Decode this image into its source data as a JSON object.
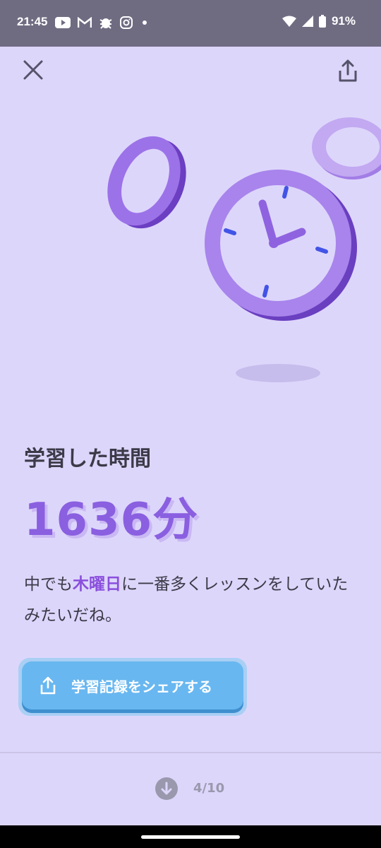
{
  "status_bar": {
    "time": "21:45",
    "notification_icons": [
      "youtube-icon",
      "gmail-icon",
      "bug-icon",
      "instagram-icon",
      "dot-icon"
    ],
    "battery": "91%"
  },
  "header": {
    "close_icon": "close-icon",
    "share_icon": "share-icon"
  },
  "stats": {
    "title": "学習した時間",
    "value": "1636分",
    "description_before": "中でも",
    "description_highlight": "木曜日",
    "description_after": "に一番多くレッスンをしていたみたいだね。"
  },
  "share_button": {
    "label": "学習記録をシェアする"
  },
  "pager": {
    "page_label": "4/10"
  },
  "colors": {
    "background": "#ddd6fb",
    "accent_purple": "#8a5fe0",
    "button_blue": "#68b7f0"
  }
}
